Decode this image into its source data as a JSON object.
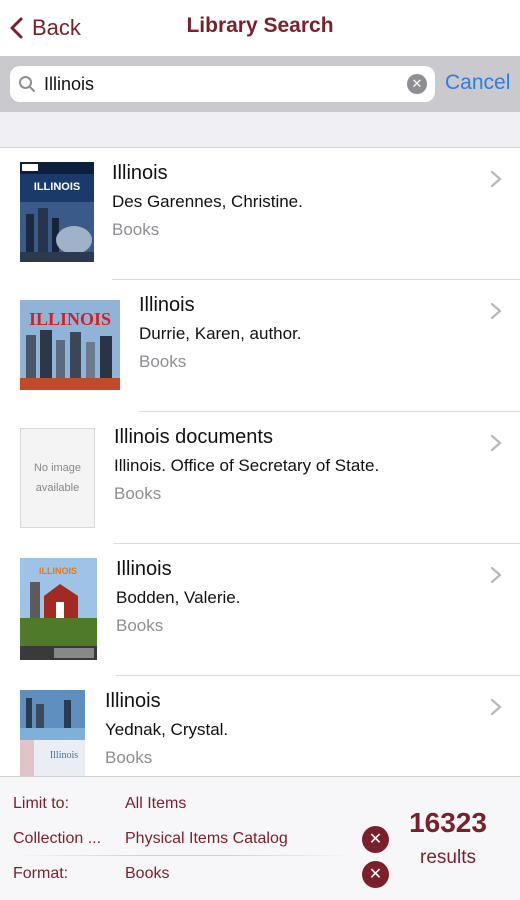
{
  "nav": {
    "back_label": "Back",
    "title": "Library Search"
  },
  "search": {
    "value": "Illinois",
    "cancel_label": "Cancel",
    "clear_icon": "clear-icon",
    "search_icon": "magnifier-icon"
  },
  "colors": {
    "accent": "#7b1f2b",
    "link_blue": "#2f7de1",
    "secondary_text": "#8e8e93"
  },
  "results": [
    {
      "title": "Illinois",
      "author": "Des Garennes, Christine.",
      "type": "Books",
      "cover": "cover-image"
    },
    {
      "title": "Illinois",
      "author": "Durrie, Karen, author.",
      "type": "Books",
      "cover": "cover-image"
    },
    {
      "title": "Illinois documents",
      "author": "Illinois. Office of Secretary of State.",
      "type": "Books",
      "cover": "no-image",
      "no_image_text": [
        "No image",
        "available"
      ]
    },
    {
      "title": "Illinois",
      "author": "Bodden, Valerie.",
      "type": "Books",
      "cover": "cover-image"
    },
    {
      "title": "Illinois",
      "author": "Yednak, Crystal.",
      "type": "Books",
      "cover": "cover-image"
    }
  ],
  "filters": [
    {
      "label": "Limit to:",
      "value": "All Items",
      "clearable": false
    },
    {
      "label": "Collection ...",
      "value": "Physical Items Catalog",
      "clearable": true
    },
    {
      "label": "Format:",
      "value": "Books",
      "clearable": true
    }
  ],
  "summary": {
    "count": "16323",
    "label": "results"
  }
}
